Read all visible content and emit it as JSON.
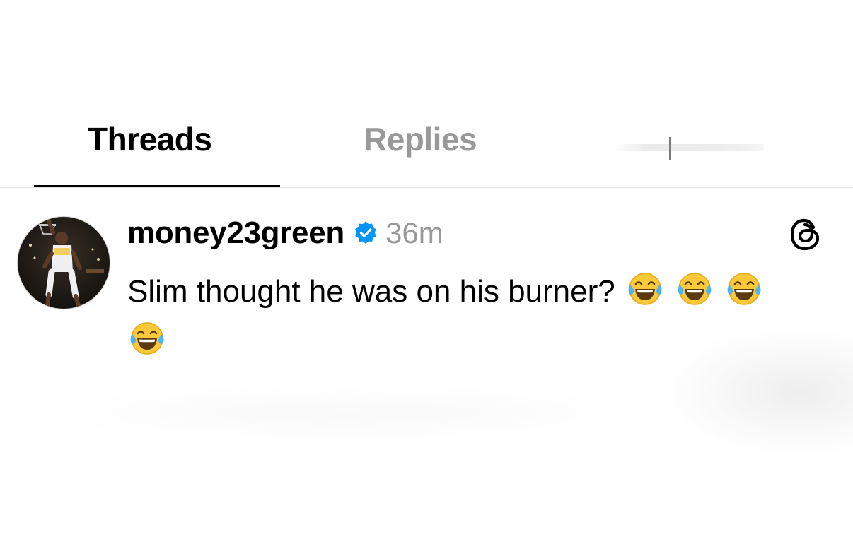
{
  "tabs": {
    "threads_label": "Threads",
    "replies_label": "Replies"
  },
  "post": {
    "username": "money23green",
    "verified": true,
    "timestamp": "36m",
    "text": "Slim thought he was on his burner?",
    "emoji_count": 4
  },
  "icons": {
    "verified": "verified-badge-icon",
    "threads": "threads-logo-icon",
    "emoji": "face-with-tears-of-joy-emoji"
  },
  "colors": {
    "active_tab": "#000000",
    "inactive_tab": "#999999",
    "verified_blue": "#0095f6",
    "timestamp": "#999999",
    "divider": "#e3e3e3"
  }
}
